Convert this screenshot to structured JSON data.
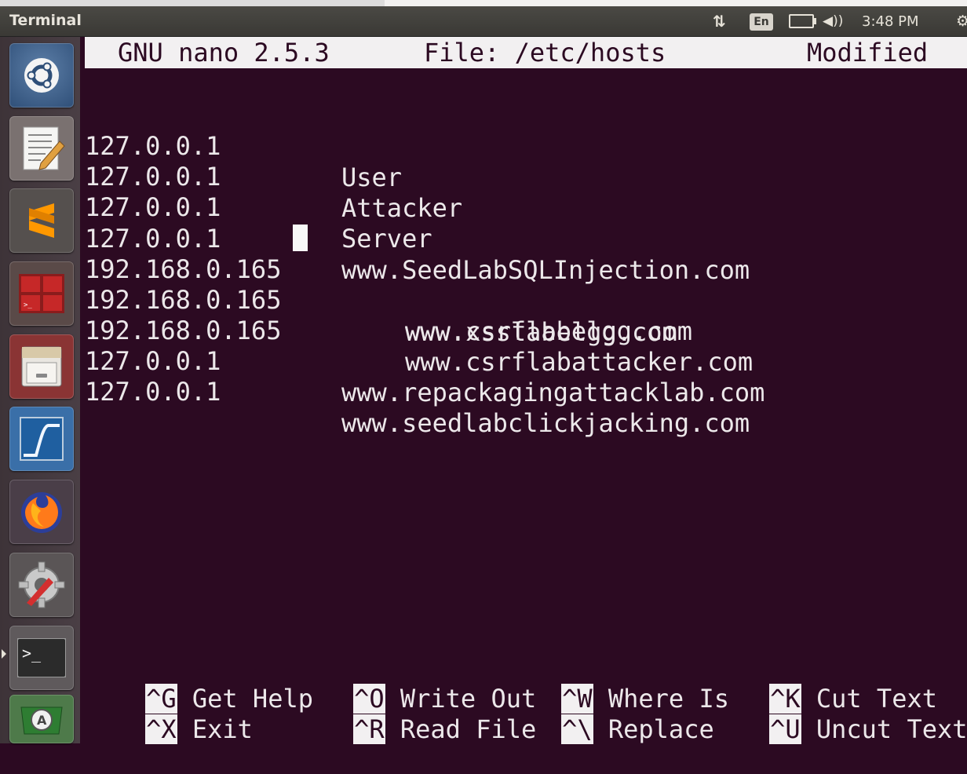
{
  "panel": {
    "app_title": "Terminal",
    "network_icon": "network-arrows-icon",
    "language": "En",
    "battery_icon": "battery-icon",
    "volume_icon": "volume-icon",
    "clock": "3:48 PM",
    "settings_icon": "gear-icon"
  },
  "launcher": {
    "items": [
      {
        "name": "ubuntu-dash-icon"
      },
      {
        "name": "text-editor-icon"
      },
      {
        "name": "sublime-text-icon"
      },
      {
        "name": "workspace-switcher-icon"
      },
      {
        "name": "file-cabinet-icon"
      },
      {
        "name": "wireshark-icon"
      },
      {
        "name": "firefox-icon"
      },
      {
        "name": "system-settings-icon"
      },
      {
        "name": "terminal-icon"
      },
      {
        "name": "software-updater-icon"
      }
    ]
  },
  "nano": {
    "version": "GNU nano 2.5.3",
    "file": "File: /etc/hosts",
    "status": "Modified",
    "lines": [
      {
        "ip": "127.0.0.1",
        "host": "User"
      },
      {
        "ip": "127.0.0.1",
        "host": "Attacker"
      },
      {
        "ip": "127.0.0.1",
        "host": "Server"
      },
      {
        "ip": "127.0.0.1",
        "host": "www.SeedLabSQLInjection.com"
      },
      {
        "ip": "192.168.0.165",
        "host": "www.xsslabelgg.com"
      },
      {
        "ip": "192.168.0.165",
        "host": "www.csrflabelgg.com"
      },
      {
        "ip": "192.168.0.165",
        "host": "www.csrflabattacker.com"
      },
      {
        "ip": "127.0.0.1",
        "host": "www.repackagingattacklab.com"
      },
      {
        "ip": "127.0.0.1",
        "host": "www.seedlabclickjacking.com"
      }
    ],
    "shortcuts": [
      {
        "key": "^G",
        "label": "Get Help"
      },
      {
        "key": "^O",
        "label": "Write Out"
      },
      {
        "key": "^W",
        "label": "Where Is"
      },
      {
        "key": "^K",
        "label": "Cut Text"
      },
      {
        "key": "^X",
        "label": "Exit"
      },
      {
        "key": "^R",
        "label": "Read File"
      },
      {
        "key": "^\\",
        "label": "Replace"
      },
      {
        "key": "^U",
        "label": "Uncut Text"
      }
    ]
  },
  "colors": {
    "terminal_bg": "#2c0a22",
    "terminal_fg": "#ece8ea",
    "panel_bg": "#3c3b37"
  }
}
